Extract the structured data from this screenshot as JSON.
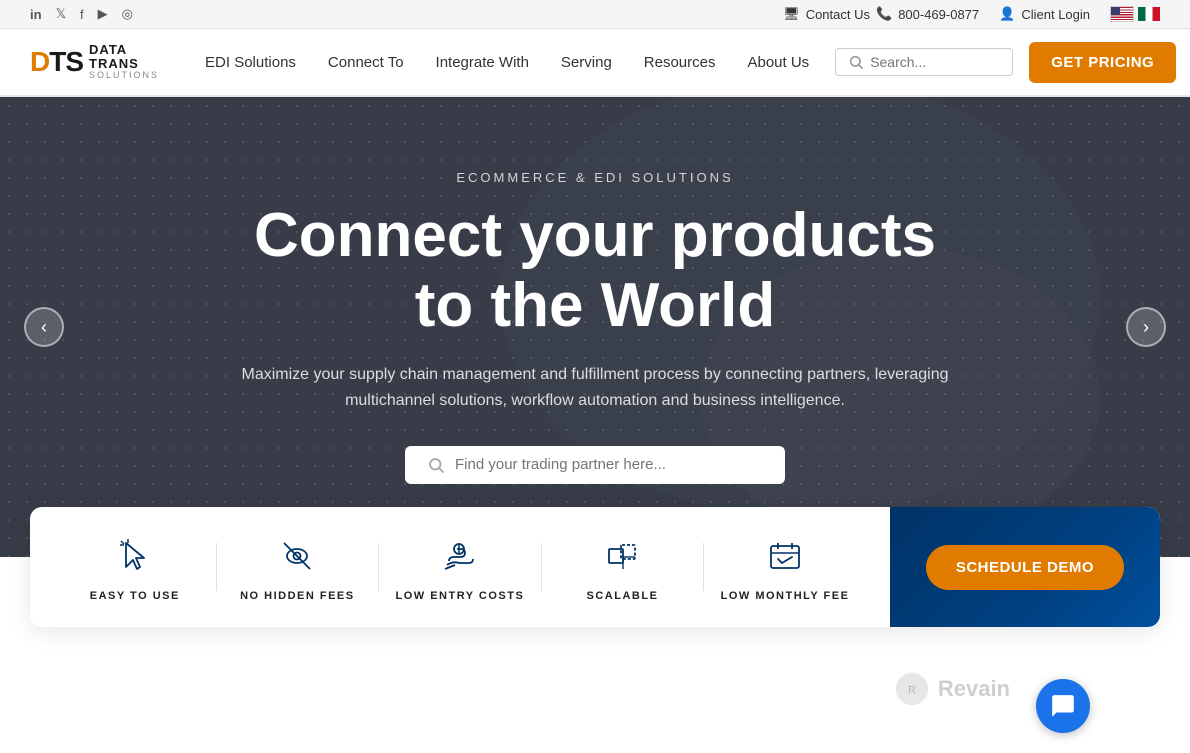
{
  "topbar": {
    "socials": [
      {
        "name": "linkedin",
        "symbol": "in"
      },
      {
        "name": "twitter",
        "symbol": "🐦"
      },
      {
        "name": "facebook",
        "symbol": "f"
      },
      {
        "name": "youtube",
        "symbol": "▶"
      },
      {
        "name": "instagram",
        "symbol": "◎"
      }
    ],
    "contact_label": "Contact Us",
    "phone": "800-469-0877",
    "client_login": "Client Login",
    "lang_us": "US",
    "lang_mx": "MX"
  },
  "navbar": {
    "logo_dts": "DTS",
    "logo_data": "DATA",
    "logo_trans": "TRANS",
    "logo_solutions": "SOLUTIONS",
    "nav_items": [
      {
        "label": "EDI Solutions",
        "id": "edi-solutions"
      },
      {
        "label": "Connect To",
        "id": "connect-to"
      },
      {
        "label": "Integrate With",
        "id": "integrate-with"
      },
      {
        "label": "Serving",
        "id": "serving"
      },
      {
        "label": "Resources",
        "id": "resources"
      },
      {
        "label": "About Us",
        "id": "about-us"
      }
    ],
    "search_placeholder": "Search...",
    "get_pricing": "GET PRICING"
  },
  "hero": {
    "subtitle": "ECOMMERCE & EDI SOLUTIONS",
    "title_line1": "Connect your products",
    "title_line2": "to the World",
    "description": "Maximize your supply chain management and fulfillment process by connecting partners, leveraging multichannel solutions, workflow automation and business intelligence.",
    "search_placeholder": "Find your trading partner here...",
    "prev_label": "‹",
    "next_label": "›"
  },
  "features": {
    "items": [
      {
        "id": "easy-to-use",
        "label": "EASY TO USE",
        "icon": "cursor"
      },
      {
        "id": "no-hidden-fees",
        "label": "NO HIDDEN FEES",
        "icon": "eye-slash"
      },
      {
        "id": "low-entry-costs",
        "label": "LOW ENTRY COSTS",
        "icon": "hand-money"
      },
      {
        "id": "scalable",
        "label": "SCALABLE",
        "icon": "resize"
      },
      {
        "id": "low-monthly-fee",
        "label": "LOW MONTHLY FEE",
        "icon": "calendar-check"
      }
    ],
    "schedule_demo": "SCHEDULE DEMO"
  }
}
